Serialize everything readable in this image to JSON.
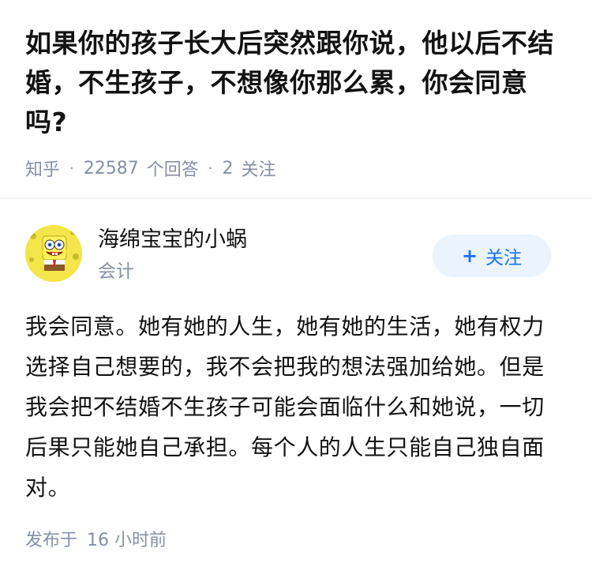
{
  "question": {
    "title": "如果你的孩子长大后突然跟你说，他以后不结婚，不生孩子，不想像你那么累，你会同意吗?",
    "source": "知乎",
    "answer_count": "22587",
    "answer_label": "个回答",
    "follow_count": "2",
    "follow_label": "关注"
  },
  "answer": {
    "author_name": "海绵宝宝的小蜗",
    "author_bio": "会计",
    "avatar_icon": "spongebob-avatar-icon",
    "follow_button_plus": "+",
    "follow_button_label": "关注",
    "content": "我会同意。她有她的人生，她有她的生活，她有权力选择自己想要的，我不会把我的想法强加给她。但是我会把不结婚不生孩子可能会面临什么和她说，一切后果只能她自己承担。每个人的人生只能自己独自面对。",
    "published_prefix": "发布于",
    "published_time": "16 小时前"
  },
  "colors": {
    "meta_gray": "#8590a6",
    "accent_blue": "#1772f6",
    "follow_bg": "#ebf4fd",
    "avatar_yellow": "#f4e64a"
  }
}
